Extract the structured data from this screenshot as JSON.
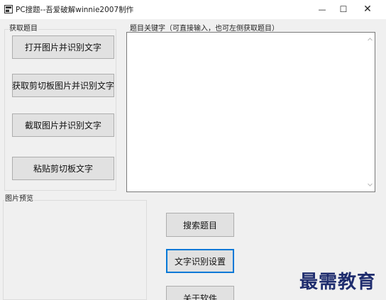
{
  "window": {
    "title": "PC搜题--吾爱破解winnie2007制作",
    "minimize_glyph": "—",
    "maximize_glyph": "☐",
    "close_glyph": "✕"
  },
  "source_group": {
    "label": "获取题目",
    "open_image_label": "打开图片并识别文字",
    "clipboard_image_label": "获取剪切板图片并识别文字",
    "capture_image_label": "截取图片并识别文字",
    "paste_text_label": "粘贴剪切板文字"
  },
  "keyword_group": {
    "label": "题目关键字（可直接输入，也可左侧获取题目）",
    "value": ""
  },
  "preview_group": {
    "label": "图片预览"
  },
  "actions": {
    "search_label": "搜索题目",
    "ocr_settings_label": "文字识别设置",
    "about_label": "关于软件"
  },
  "watermark": "最需教育",
  "colors": {
    "focus_border": "#0078d7",
    "button_face": "#e1e1e1",
    "watermark": "#1f2d6e"
  }
}
